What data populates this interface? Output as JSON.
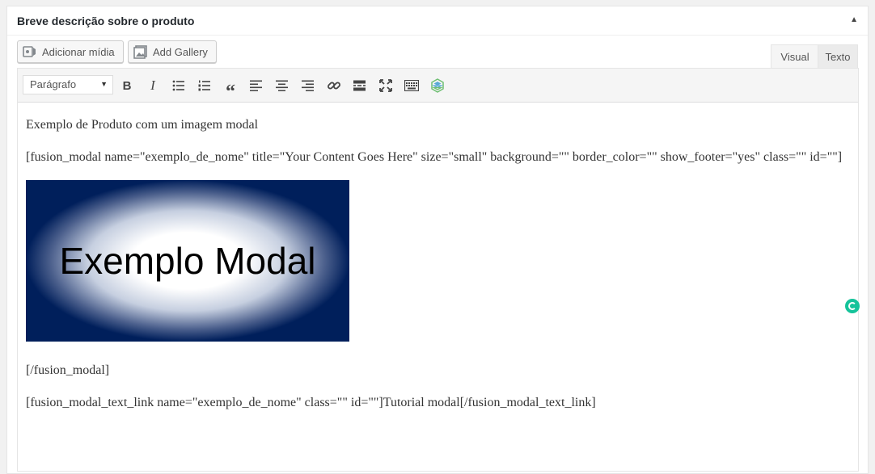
{
  "postbox": {
    "title": "Breve descrição sobre o produto",
    "toggle_icon": "arrow-up-icon"
  },
  "media_buttons": {
    "add_media": "Adicionar mídia",
    "add_gallery": "Add Gallery"
  },
  "tabs": {
    "visual": "Visual",
    "text": "Texto",
    "active": "visual"
  },
  "toolbar": {
    "format_value": "Parágrafo",
    "icons": [
      "bold-icon",
      "italic-icon",
      "bulleted-list-icon",
      "numbered-list-icon",
      "blockquote-icon",
      "align-left-icon",
      "align-center-icon",
      "align-right-icon",
      "link-icon",
      "read-more-icon",
      "fullscreen-icon",
      "toolbar-toggle-icon",
      "fusion-builder-icon"
    ]
  },
  "content": {
    "p1": "Exemplo de Produto com um imagem modal",
    "p2": "[fusion_modal name=\"exemplo_de_nome\" title=\"Your Content Goes Here\" size=\"small\" background=\"\" border_color=\"\" show_footer=\"yes\" class=\"\" id=\"\"]",
    "image_text": "Exemplo Modal",
    "p3": "[/fusion_modal]",
    "p4": "[fusion_modal_text_link name=\"exemplo_de_nome\" class=\"\" id=\"\"]Tutorial modal[/fusion_modal_text_link]"
  },
  "colors": {
    "image_bg": "#001f5b",
    "grammarly": "#15c39a"
  }
}
